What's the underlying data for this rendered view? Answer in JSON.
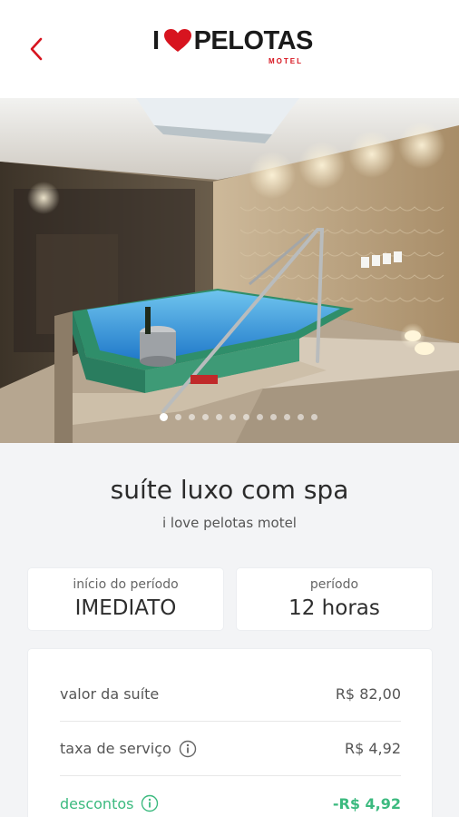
{
  "header": {
    "logo_prefix": "I",
    "logo_name": "PELOTAS",
    "logo_sub": "MOTEL",
    "back_icon": "chevron-left-icon",
    "accent_color": "#d7141f"
  },
  "carousel": {
    "active_index": 0,
    "count": 12
  },
  "suite": {
    "title": "suíte luxo com spa",
    "subtitle": "i love pelotas motel"
  },
  "period": {
    "start_label": "início do período",
    "start_value": "IMEDIATO",
    "duration_label": "período",
    "duration_value": "12 horas"
  },
  "pricing": {
    "suite_label": "valor da suíte",
    "suite_value": "R$ 82,00",
    "fee_label": "taxa de serviço",
    "fee_value": "R$ 4,92",
    "discount_label": "descontos",
    "discount_value": "-R$ 4,92",
    "discount_color": "#3cba7f"
  }
}
